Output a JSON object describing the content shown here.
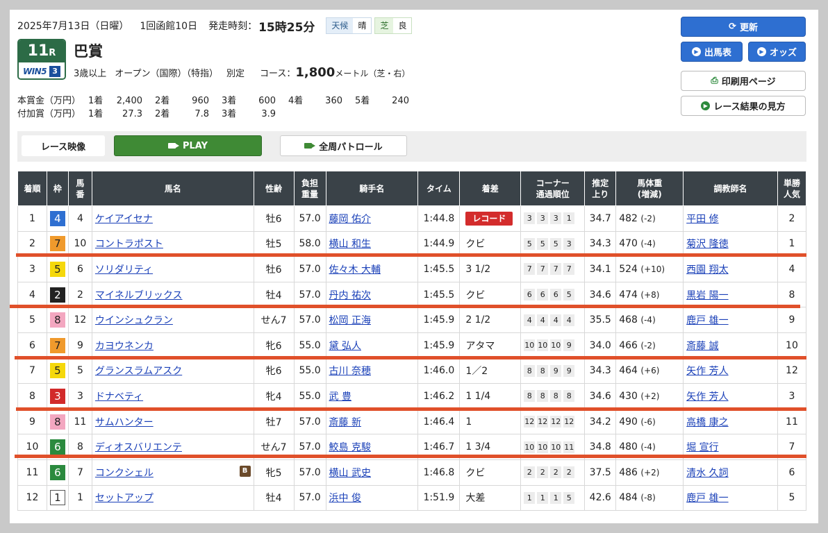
{
  "header": {
    "date": "2025年7月13日（日曜）",
    "meeting": "1回函館10日",
    "post_label": "発走時刻：",
    "post_time": "15時25分",
    "weather_label": "天候",
    "weather_value": "晴",
    "track_label": "芝",
    "track_value": "良"
  },
  "race": {
    "number": "11",
    "number_suffix": "R",
    "win5_logo": "WIN5",
    "win5_leg": "3",
    "name": "巴賞",
    "age": "3歳以上",
    "class": "オープン（国際）（特指）",
    "weight_rule": "別定",
    "course_label": "コース：",
    "distance": "1,800",
    "distance_unit": "メートル（芝・右）"
  },
  "prize": {
    "main_label": "本賞金（万円）",
    "main": [
      {
        "place": "1着",
        "value": "2,400"
      },
      {
        "place": "2着",
        "value": "960"
      },
      {
        "place": "3着",
        "value": "600"
      },
      {
        "place": "4着",
        "value": "360"
      },
      {
        "place": "5着",
        "value": "240"
      }
    ],
    "extra_label": "付加賞（万円）",
    "extra": [
      {
        "place": "1着",
        "value": "27.3"
      },
      {
        "place": "2着",
        "value": "7.8"
      },
      {
        "place": "3着",
        "value": "3.9"
      }
    ]
  },
  "buttons": {
    "update": "更新",
    "entries": "出馬表",
    "odds": "オッズ",
    "print": "印刷用ページ",
    "guide": "レース結果の見方"
  },
  "video": {
    "label": "レース映像",
    "play": "PLAY",
    "patrol": "全周パトロール"
  },
  "table": {
    "headers": [
      "着順",
      "枠",
      "馬番",
      "馬名",
      "性齢",
      "負担重量",
      "騎手名",
      "タイム",
      "着差",
      "コーナー通過順位",
      "推定上り",
      "馬体重(増減)",
      "調教師名",
      "単勝人気"
    ],
    "rows": [
      {
        "pos": "1",
        "frame": "4",
        "num": "4",
        "horse": "ケイアイセナ",
        "badge": "",
        "sex_age": "牡6",
        "weight": "57.0",
        "jockey": "藤岡 佑介",
        "time": "1:44.8",
        "margin": "レコード",
        "record": true,
        "corners": [
          "3",
          "3",
          "3",
          "1"
        ],
        "last3f": "34.7",
        "body": "482",
        "diff": "(-2)",
        "trainer": "平田 修",
        "pop": "2"
      },
      {
        "pos": "2",
        "frame": "7",
        "num": "10",
        "horse": "コントラポスト",
        "badge": "",
        "sex_age": "牡5",
        "weight": "58.0",
        "jockey": "横山 和生",
        "time": "1:44.9",
        "margin": "クビ",
        "record": false,
        "corners": [
          "5",
          "5",
          "5",
          "3"
        ],
        "last3f": "34.3",
        "body": "470",
        "diff": "(-4)",
        "trainer": "菊沢 隆徳",
        "pop": "1"
      },
      {
        "pos": "3",
        "frame": "5",
        "num": "6",
        "horse": "ソリダリティ",
        "badge": "",
        "sex_age": "牡6",
        "weight": "57.0",
        "jockey": "佐々木 大輔",
        "time": "1:45.5",
        "margin": "3 1/2",
        "record": false,
        "corners": [
          "7",
          "7",
          "7",
          "7"
        ],
        "last3f": "34.1",
        "body": "524",
        "diff": "(+10)",
        "trainer": "西園 翔太",
        "pop": "4"
      },
      {
        "pos": "4",
        "frame": "2",
        "num": "2",
        "horse": "マイネルブリックス",
        "badge": "",
        "sex_age": "牡4",
        "weight": "57.0",
        "jockey": "丹内 祐次",
        "time": "1:45.5",
        "margin": "クビ",
        "record": false,
        "corners": [
          "6",
          "6",
          "6",
          "5"
        ],
        "last3f": "34.6",
        "body": "474",
        "diff": "(+8)",
        "trainer": "黒岩 陽一",
        "pop": "8"
      },
      {
        "pos": "5",
        "frame": "8",
        "num": "12",
        "horse": "ウインシュクラン",
        "badge": "",
        "sex_age": "せん7",
        "weight": "57.0",
        "jockey": "松岡 正海",
        "time": "1:45.9",
        "margin": "2 1/2",
        "record": false,
        "corners": [
          "4",
          "4",
          "4",
          "4"
        ],
        "last3f": "35.5",
        "body": "468",
        "diff": "(-4)",
        "trainer": "鹿戸 雄一",
        "pop": "9"
      },
      {
        "pos": "6",
        "frame": "7",
        "num": "9",
        "horse": "カヨウネンカ",
        "badge": "",
        "sex_age": "牝6",
        "weight": "55.0",
        "jockey": "黛 弘人",
        "time": "1:45.9",
        "margin": "アタマ",
        "record": false,
        "corners": [
          "10",
          "10",
          "10",
          "9"
        ],
        "last3f": "34.0",
        "body": "466",
        "diff": "(-2)",
        "trainer": "斎藤 誠",
        "pop": "10"
      },
      {
        "pos": "7",
        "frame": "5",
        "num": "5",
        "horse": "グランスラムアスク",
        "badge": "",
        "sex_age": "牝6",
        "weight": "55.0",
        "jockey": "古川 奈穂",
        "time": "1:46.0",
        "margin": "1／2",
        "record": false,
        "corners": [
          "8",
          "8",
          "9",
          "9"
        ],
        "last3f": "34.3",
        "body": "464",
        "diff": "(+6)",
        "trainer": "矢作 芳人",
        "pop": "12"
      },
      {
        "pos": "8",
        "frame": "3",
        "num": "3",
        "horse": "ドナベティ",
        "badge": "",
        "sex_age": "牝4",
        "weight": "55.0",
        "jockey": "武 豊",
        "time": "1:46.2",
        "margin": "1 1/4",
        "record": false,
        "corners": [
          "8",
          "8",
          "8",
          "8"
        ],
        "last3f": "34.6",
        "body": "430",
        "diff": "(+2)",
        "trainer": "矢作 芳人",
        "pop": "3"
      },
      {
        "pos": "9",
        "frame": "8",
        "num": "11",
        "horse": "サムハンター",
        "badge": "",
        "sex_age": "牡7",
        "weight": "57.0",
        "jockey": "斎藤 新",
        "time": "1:46.4",
        "margin": "1",
        "record": false,
        "corners": [
          "12",
          "12",
          "12",
          "12"
        ],
        "last3f": "34.2",
        "body": "490",
        "diff": "(-6)",
        "trainer": "高橋 康之",
        "pop": "11"
      },
      {
        "pos": "10",
        "frame": "6",
        "num": "8",
        "horse": "ディオスバリエンテ",
        "badge": "",
        "sex_age": "せん7",
        "weight": "57.0",
        "jockey": "鮫島 克駿",
        "time": "1:46.7",
        "margin": "1 3/4",
        "record": false,
        "corners": [
          "10",
          "10",
          "10",
          "11"
        ],
        "last3f": "34.8",
        "body": "480",
        "diff": "(-4)",
        "trainer": "堀 宣行",
        "pop": "7"
      },
      {
        "pos": "11",
        "frame": "6",
        "num": "7",
        "horse": "コンクシェル",
        "badge": "B",
        "sex_age": "牝5",
        "weight": "57.0",
        "jockey": "横山 武史",
        "time": "1:46.8",
        "margin": "クビ",
        "record": false,
        "corners": [
          "2",
          "2",
          "2",
          "2"
        ],
        "last3f": "37.5",
        "body": "486",
        "diff": "(+2)",
        "trainer": "清水 久詞",
        "pop": "6"
      },
      {
        "pos": "12",
        "frame": "1",
        "num": "1",
        "horse": "セットアップ",
        "badge": "",
        "sex_age": "牡4",
        "weight": "57.0",
        "jockey": "浜中 俊",
        "time": "1:51.9",
        "margin": "大差",
        "record": false,
        "corners": [
          "1",
          "1",
          "1",
          "5"
        ],
        "last3f": "42.6",
        "body": "484",
        "diff": "(-8)",
        "trainer": "鹿戸 雄一",
        "pop": "5"
      }
    ]
  },
  "colors": {
    "accent_blue": "#2e6fd1",
    "play_green": "#3f8a35",
    "header_dark": "#3a4248",
    "annotation_red": "#e0502a",
    "link": "#1a40b8"
  }
}
